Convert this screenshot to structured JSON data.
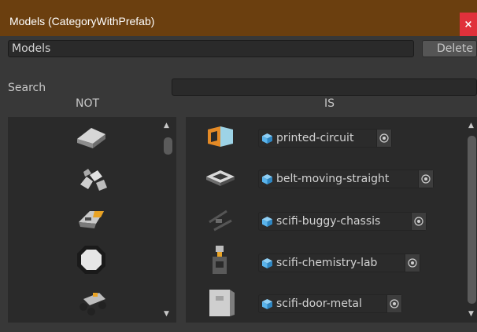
{
  "window": {
    "title": "Models (CategoryWithPrefab)",
    "close_label": "×"
  },
  "category": {
    "name_value": "Models",
    "delete_label": "Delete"
  },
  "search": {
    "label": "Search",
    "value": ""
  },
  "columns": {
    "not_label": "NOT",
    "is_label": "IS"
  },
  "not_list": {
    "items": [
      {
        "icon": "gray-ramp-model-icon"
      },
      {
        "icon": "rock-cluster-model-icon"
      },
      {
        "icon": "scifi-craft-model-icon"
      },
      {
        "icon": "octagon-ring-model-icon"
      },
      {
        "icon": "buggy-model-icon"
      }
    ]
  },
  "is_list": {
    "items": [
      {
        "label": "printed-circuit",
        "icon": "prefab-cube-icon"
      },
      {
        "label": "belt-moving-straight",
        "icon": "prefab-cube-icon"
      },
      {
        "label": "scifi-buggy-chassis",
        "icon": "prefab-cube-icon"
      },
      {
        "label": "scifi-chemistry-lab",
        "icon": "prefab-cube-icon"
      },
      {
        "label": "scifi-door-metal",
        "icon": "prefab-cube-icon"
      }
    ]
  },
  "colors": {
    "title_bar": "#6b3f0f",
    "close_button": "#e0313b",
    "panel": "#383838",
    "list_background": "#2a2a2a",
    "prefab_icon": "#5ab4ec"
  }
}
